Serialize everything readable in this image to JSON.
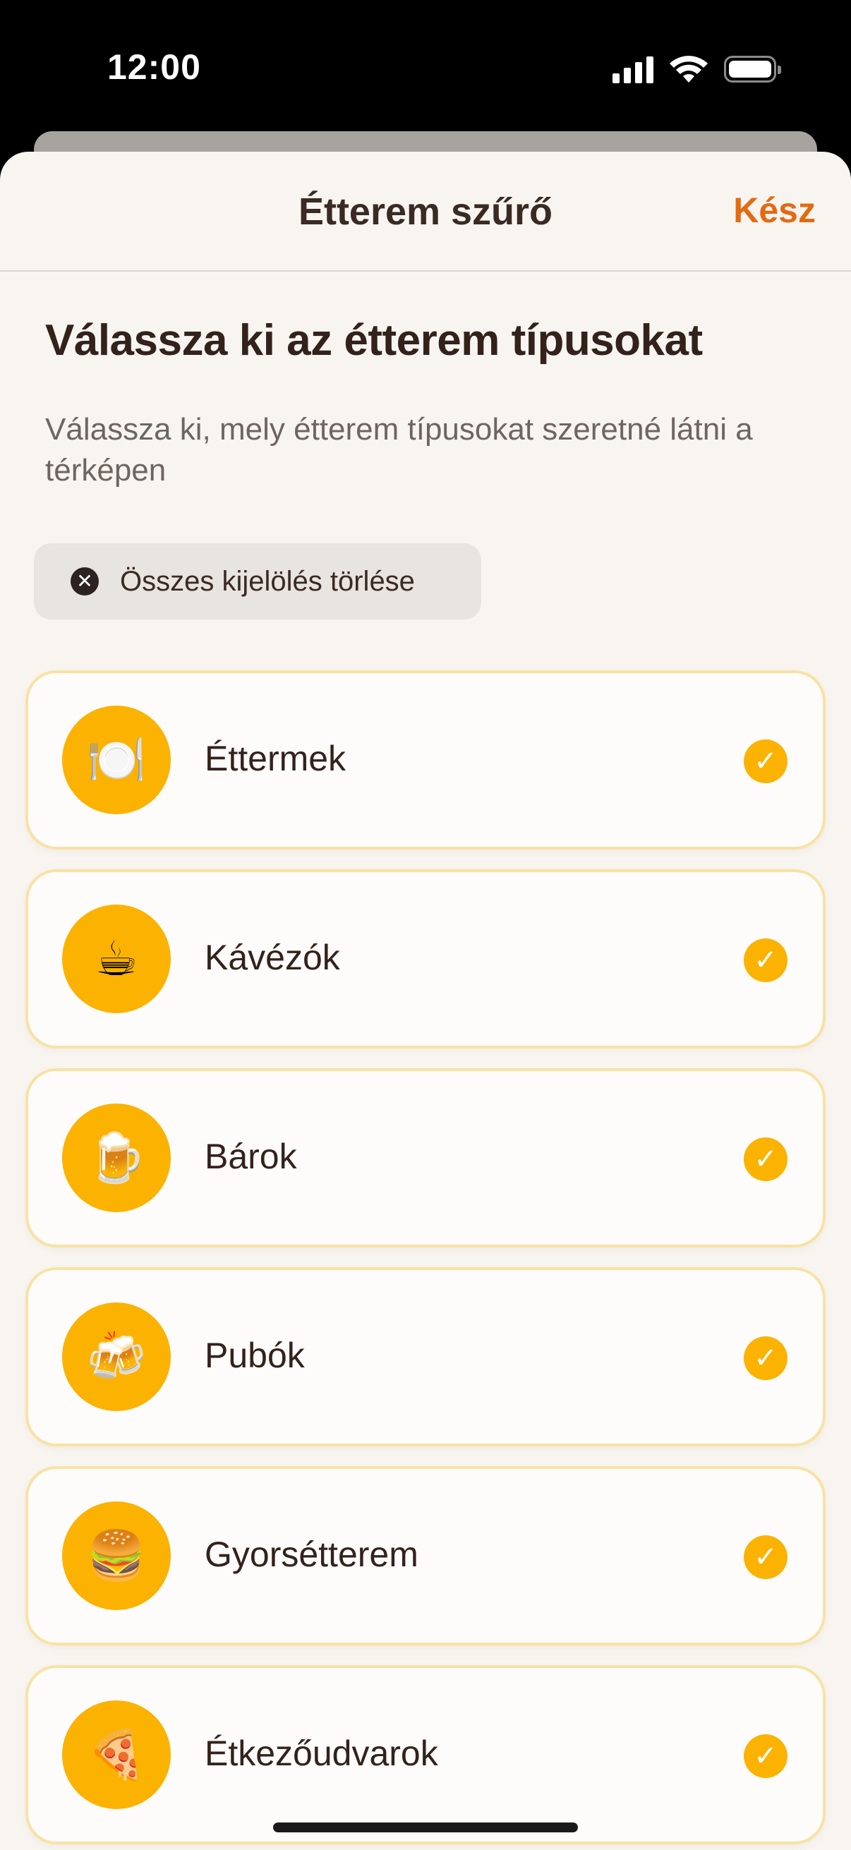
{
  "status_bar": {
    "time": "12:00",
    "signal_icon": "cellular-signal-icon",
    "wifi_icon": "wifi-icon",
    "battery_icon": "battery-icon"
  },
  "nav": {
    "title": "Étterem szűrő",
    "done_label": "Kész"
  },
  "heading": "Válassza ki az étterem típusokat",
  "subtitle": "Válassza ki, mely étterem típusokat szeretné látni a térképen",
  "clear_button": {
    "icon": "close-circle-icon",
    "label": "Összes kijelölés törlése"
  },
  "categories": [
    {
      "label": "Éttermek",
      "emoji": "🍽️",
      "icon": "plate-cutlery-icon",
      "selected": true
    },
    {
      "label": "Kávézók",
      "emoji": "☕",
      "icon": "coffee-cup-icon",
      "selected": true
    },
    {
      "label": "Bárok",
      "emoji": "🍺",
      "icon": "beer-mug-icon",
      "selected": true
    },
    {
      "label": "Pubók",
      "emoji": "🍻",
      "icon": "clinking-beers-icon",
      "selected": true
    },
    {
      "label": "Gyorsétterem",
      "emoji": "🍔",
      "icon": "burger-icon",
      "selected": true
    },
    {
      "label": "Étkezőudvarok",
      "emoji": "🍕",
      "icon": "pizza-icon",
      "selected": true
    }
  ],
  "colors": {
    "accent": "#e46a12",
    "icon_bg": "#fcb200",
    "card_border": "#f8e2a4",
    "sheet_bg": "#f8f5f1"
  }
}
